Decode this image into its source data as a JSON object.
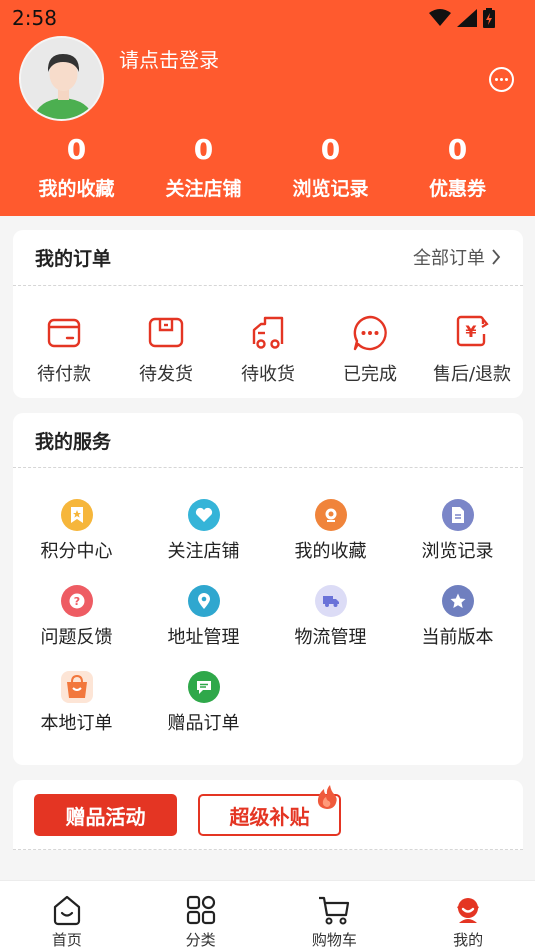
{
  "status_bar": {
    "time": "2:58"
  },
  "profile": {
    "login_prompt": "请点击登录"
  },
  "stats": [
    {
      "value": "0",
      "label": "我的收藏"
    },
    {
      "value": "0",
      "label": "关注店铺"
    },
    {
      "value": "0",
      "label": "浏览记录"
    },
    {
      "value": "0",
      "label": "优惠券"
    }
  ],
  "orders": {
    "title": "我的订单",
    "all_orders": "全部订单",
    "items": [
      {
        "label": "待付款",
        "icon": "wallet-icon"
      },
      {
        "label": "待发货",
        "icon": "package-icon"
      },
      {
        "label": "待收货",
        "icon": "truck-icon"
      },
      {
        "label": "已完成",
        "icon": "chat-done-icon"
      },
      {
        "label": "售后/退款",
        "icon": "refund-icon"
      }
    ]
  },
  "services": {
    "title": "我的服务",
    "items": [
      {
        "label": "积分中心",
        "icon": "points-icon"
      },
      {
        "label": "关注店铺",
        "icon": "heart-icon"
      },
      {
        "label": "我的收藏",
        "icon": "favorite-icon"
      },
      {
        "label": "浏览记录",
        "icon": "history-icon"
      },
      {
        "label": "问题反馈",
        "icon": "question-icon"
      },
      {
        "label": "地址管理",
        "icon": "location-icon"
      },
      {
        "label": "物流管理",
        "icon": "delivery-icon"
      },
      {
        "label": "当前版本",
        "icon": "star-icon"
      },
      {
        "label": "本地订单",
        "icon": "bag-icon"
      },
      {
        "label": "赠品订单",
        "icon": "gift-order-icon"
      }
    ]
  },
  "promo": {
    "gift_activity": "赠品活动",
    "super_subsidy": "超级补贴"
  },
  "tabbar": [
    {
      "label": "首页",
      "icon": "home-icon"
    },
    {
      "label": "分类",
      "icon": "category-icon"
    },
    {
      "label": "购物车",
      "icon": "cart-icon"
    },
    {
      "label": "我的",
      "icon": "profile-icon",
      "active": true
    }
  ],
  "colors": {
    "brand": "#ff5a2e",
    "accent_red": "#e43523"
  }
}
